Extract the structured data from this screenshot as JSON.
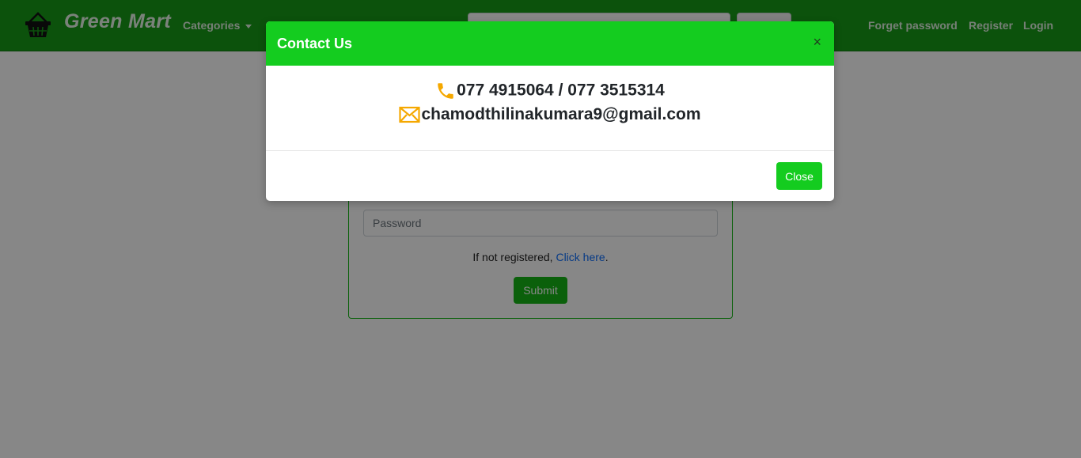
{
  "navbar": {
    "brand": "Green Mart",
    "categories_label": "Categories",
    "search_placeholder": "",
    "search_button_label": "",
    "links": [
      "Forget password",
      "Register",
      "Login"
    ]
  },
  "login": {
    "password_placeholder": "Password",
    "register_prefix": "If not registered, ",
    "register_link": "Click here",
    "register_suffix": ".",
    "submit_label": "Submit"
  },
  "modal": {
    "title": "Contact Us",
    "close_x": "×",
    "phone": "077 4915064 / 077 3515314",
    "email": "chamodthilinakumara9@gmail.com",
    "close_label": "Close",
    "phone_icon": "phone-icon",
    "email_icon": "envelope-icon"
  },
  "colors": {
    "navbar": "#179c17",
    "modal_header": "#14cc1f",
    "accent_icon": "#f5a800",
    "link": "#0d6efd"
  }
}
